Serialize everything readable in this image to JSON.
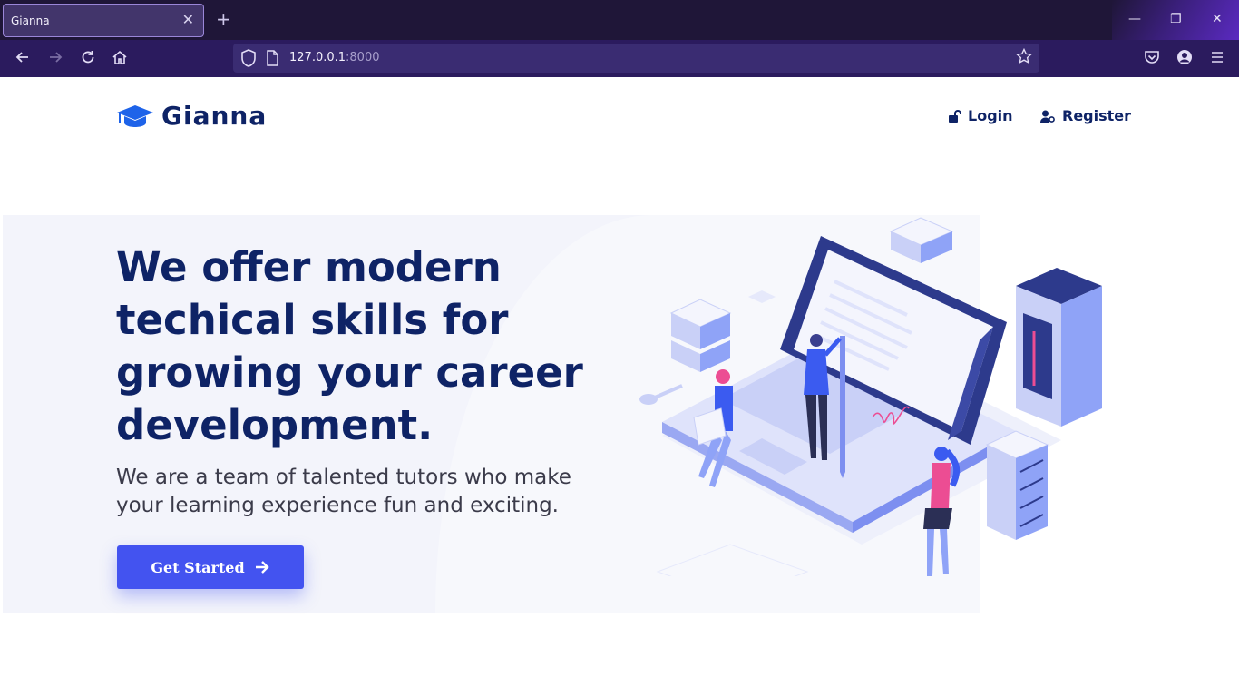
{
  "browser": {
    "tab_title": "Gianna",
    "tab_close": "✕",
    "new_tab": "+",
    "url_host": "127.0.0.1",
    "url_port": ":8000",
    "window_controls": {
      "minimize": "—",
      "restore": "❐",
      "close": "✕"
    }
  },
  "site": {
    "brand": "Gianna",
    "nav": {
      "login": "Login",
      "register": "Register"
    },
    "hero": {
      "title": "We offer modern techical skills for growing your career development.",
      "subtitle": "We are a team of talented tutors who make your learning experience fun and exciting.",
      "cta_label": "Get Started"
    }
  },
  "colors": {
    "brand_navy": "#0e2366",
    "accent_blue": "#4353f0",
    "browser_dark": "#1f1638",
    "browser_nav": "#2b1b5e"
  },
  "icons": {
    "logo": "graduation-cap-icon",
    "login": "unlock-icon",
    "register": "user-cog-icon",
    "cta": "arrow-right-icon"
  }
}
